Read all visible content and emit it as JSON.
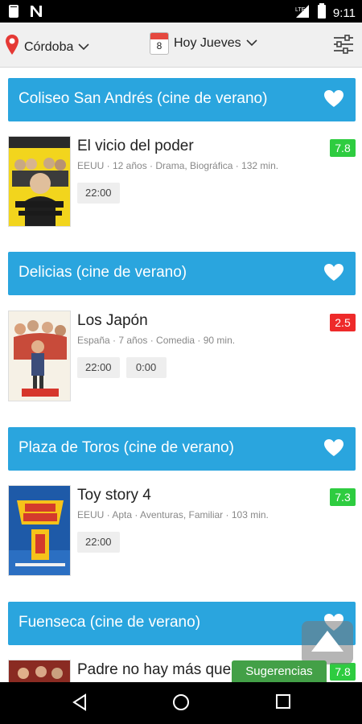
{
  "status_bar": {
    "time": "9:11",
    "left_icons": [
      "notification-icon",
      "n-app-icon"
    ],
    "right_icons": [
      "signal-icon",
      "battery-icon"
    ]
  },
  "top_bar": {
    "location": "Córdoba",
    "date_label": "Hoy Jueves",
    "calendar_day": "8",
    "icons": [
      "location-pin-icon",
      "chevron-down-icon",
      "calendar-icon",
      "filter-sliders-icon"
    ]
  },
  "cinemas": [
    {
      "name": "Coliseo San Andrés (cine de verano)",
      "movies": [
        {
          "title": "El vicio del poder",
          "meta": "EEUU · 12 años · Drama, Biográfica · 132 min.",
          "rating": "7.8",
          "rating_color": "#2ecc40",
          "times": [
            "22:00"
          ]
        }
      ]
    },
    {
      "name": "Delicias (cine de verano)",
      "movies": [
        {
          "title": "Los Japón",
          "meta": "España · 7 años · Comedia · 90 min.",
          "rating": "2.5",
          "rating_color": "#ee2a2a",
          "times": [
            "22:00",
            "0:00"
          ]
        }
      ]
    },
    {
      "name": "Plaza de Toros (cine de verano)",
      "movies": [
        {
          "title": "Toy story 4",
          "meta": "EEUU · Apta · Aventuras, Familiar · 103 min.",
          "rating": "7.3",
          "rating_color": "#2ecc40",
          "times": [
            "22:00"
          ]
        }
      ]
    },
    {
      "name": "Fuenseca (cine de verano)",
      "movies": [
        {
          "title": "Padre no hay más que uno",
          "rating": "7.8",
          "rating_color": "#2ecc40"
        }
      ]
    }
  ],
  "floating": {
    "suggestions_label": "Sugerencias"
  },
  "colors": {
    "header_blue": "#2aa5de",
    "green": "#2ecc40",
    "red": "#ee2a2a",
    "suggest_green": "#43a047"
  }
}
